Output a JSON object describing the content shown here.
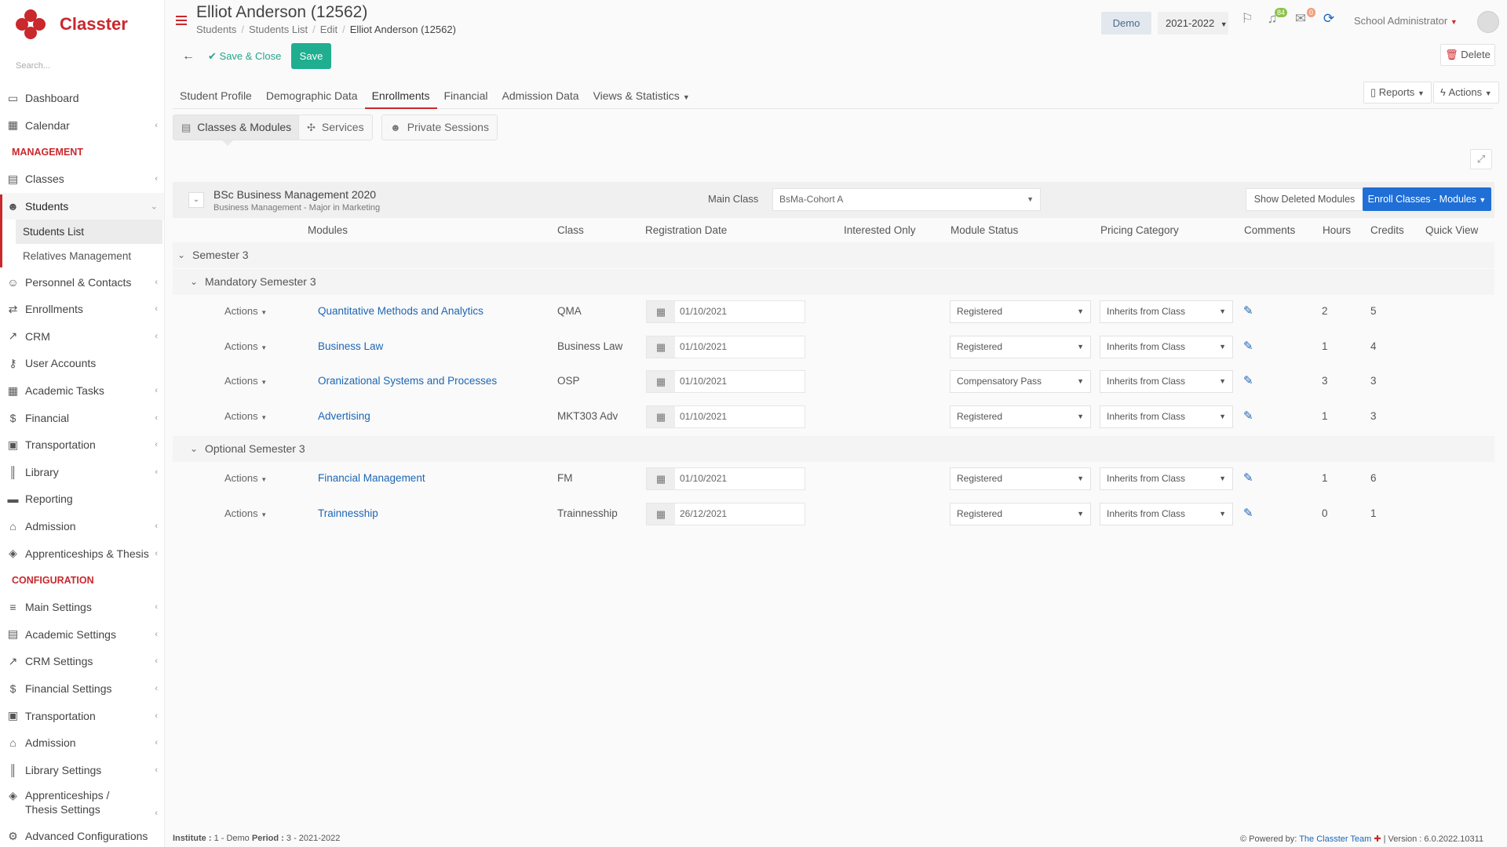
{
  "app": {
    "name": "Classter"
  },
  "sidebar": {
    "search_placeholder": "Search...",
    "items_top": [
      {
        "label": "Dashboard"
      },
      {
        "label": "Calendar"
      }
    ],
    "management_label": "MANAGEMENT",
    "management": [
      {
        "label": "Classes"
      },
      {
        "label": "Students"
      },
      {
        "label": "Personnel & Contacts"
      },
      {
        "label": "Enrollments"
      },
      {
        "label": "CRM"
      },
      {
        "label": "User Accounts"
      },
      {
        "label": "Academic Tasks"
      },
      {
        "label": "Financial"
      },
      {
        "label": "Transportation"
      },
      {
        "label": "Library"
      },
      {
        "label": "Reporting"
      },
      {
        "label": "Admission"
      },
      {
        "label": "Apprenticeships & Thesis"
      }
    ],
    "students_sub": [
      {
        "label": "Students List"
      },
      {
        "label": "Relatives Management"
      }
    ],
    "configuration_label": "CONFIGURATION",
    "configuration": [
      {
        "label": "Main Settings"
      },
      {
        "label": "Academic Settings"
      },
      {
        "label": "CRM Settings"
      },
      {
        "label": "Financial Settings"
      },
      {
        "label": "Transportation"
      },
      {
        "label": "Admission"
      },
      {
        "label": "Library Settings"
      },
      {
        "label": "Apprenticeships / Thesis Settings"
      },
      {
        "label": "Advanced Configurations"
      }
    ]
  },
  "header": {
    "title": "Elliot Anderson (12562)",
    "breadcrumb": [
      "Students",
      "Students List",
      "Edit",
      "Elliot Anderson (12562)"
    ],
    "demo_label": "Demo",
    "year_label": "2021-2022",
    "notifications_count": "84",
    "messages_count": "0",
    "user_label": "School Administrator"
  },
  "toolbar": {
    "save_close_label": "Save & Close",
    "save_label": "Save",
    "delete_label": "Delete"
  },
  "tabs": [
    {
      "label": "Student Profile"
    },
    {
      "label": "Demographic Data"
    },
    {
      "label": "Enrollments"
    },
    {
      "label": "Financial"
    },
    {
      "label": "Admission Data"
    },
    {
      "label": "Views & Statistics"
    }
  ],
  "tab_actions": {
    "reports_label": "Reports",
    "actions_label": "Actions"
  },
  "subtabs": [
    {
      "label": "Classes & Modules"
    },
    {
      "label": "Services"
    },
    {
      "label": "Private Sessions"
    }
  ],
  "program": {
    "title": "BSc Business Management 2020",
    "subtitle": "Business Management - Major in Marketing",
    "main_class_label": "Main Class",
    "main_class_value": "BsMa-Cohort A",
    "show_deleted_label": "Show Deleted Modules",
    "enroll_label": "Enroll Classes - Modules"
  },
  "table": {
    "headers": {
      "modules": "Modules",
      "class": "Class",
      "registration_date": "Registration Date",
      "interested_only": "Interested Only",
      "module_status": "Module Status",
      "pricing_category": "Pricing Category",
      "comments": "Comments",
      "hours": "Hours",
      "credits": "Credits",
      "quick_view": "Quick View"
    },
    "semester_label": "Semester 3",
    "mandatory_label": "Mandatory Semester 3",
    "optional_label": "Optional Semester 3",
    "actions_label": "Actions",
    "mandatory_rows": [
      {
        "module": "Quantitative Methods and Analytics",
        "class": "QMA",
        "date": "01/10/2021",
        "status": "Registered",
        "pricing": "Inherits from Class",
        "hours": "2",
        "credits": "5"
      },
      {
        "module": "Business Law",
        "class": "Business Law",
        "date": "01/10/2021",
        "status": "Registered",
        "pricing": "Inherits from Class",
        "hours": "1",
        "credits": "4"
      },
      {
        "module": "Oranizational Systems and Processes",
        "class": "OSP",
        "date": "01/10/2021",
        "status": "Compensatory Pass",
        "pricing": "Inherits from Class",
        "hours": "3",
        "credits": "3"
      },
      {
        "module": "Advertising",
        "class": "MKT303 Adv",
        "date": "01/10/2021",
        "status": "Registered",
        "pricing": "Inherits from Class",
        "hours": "1",
        "credits": "3"
      }
    ],
    "optional_rows": [
      {
        "module": "Financial Management",
        "class": "FM",
        "date": "01/10/2021",
        "status": "Registered",
        "pricing": "Inherits from Class",
        "hours": "1",
        "credits": "6"
      },
      {
        "module": "Trainnesship",
        "class": "Trainnesship",
        "date": "26/12/2021",
        "status": "Registered",
        "pricing": "Inherits from Class",
        "hours": "0",
        "credits": "1"
      }
    ]
  },
  "footer": {
    "institute_label": "Institute :",
    "institute_value": "1 - Demo",
    "period_label": "Period :",
    "period_value": "3 - 2021-2022",
    "powered_label": "Powered by:",
    "powered_link": "The Classter Team",
    "version": "| Version : 6.0.2022.10311"
  },
  "colors": {
    "brand": "#c9282d",
    "primary": "#1f6fd6",
    "success": "#1fae8f",
    "link": "#1c66b5"
  }
}
